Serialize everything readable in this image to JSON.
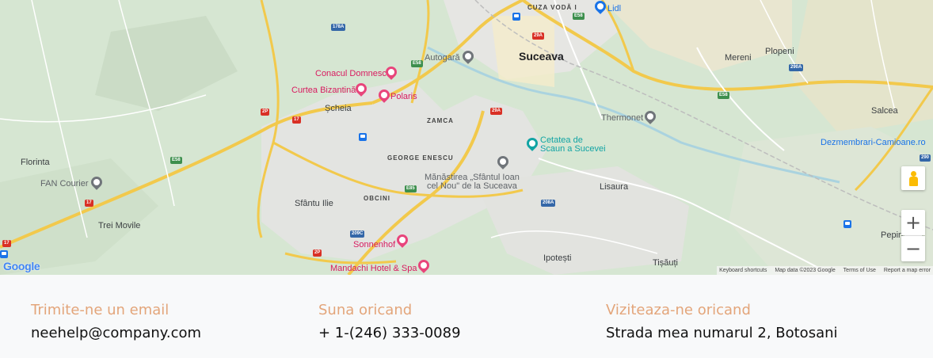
{
  "map": {
    "cities": {
      "suceava": "Suceava"
    },
    "towns": {
      "scheia": "Șcheia",
      "florinta": "Florinta",
      "trei_movile": "Trei Movile",
      "sfantu_ilie": "Sfântu Ilie",
      "lisaura": "Lisaura",
      "ipotesti": "Ipotești",
      "tisauti": "Tișăuți",
      "mereni": "Mereni",
      "plopeni": "Plopeni",
      "salcea": "Salcea",
      "pepin": "Pepin",
      "cuza_voda": "CUZA VODĂ I"
    },
    "districts": {
      "zamca": "ZAMCA",
      "george_enescu": "GEORGE ENESCU",
      "obcini": "OBCINI"
    },
    "pois": {
      "conacul": "Conacul Domnesc",
      "curtea": "Curtea Bizantină",
      "polaris": "Polaris",
      "autogara": "Autogară",
      "thermonet": "Thermonet",
      "cetatea_1": "Cetatea de",
      "cetatea_2": "Scaun a Sucevei",
      "manastirea_1": "Mănăstirea „Sfântul Ioan",
      "manastirea_2": "cel Nou\" de la Suceava",
      "fan_courier": "FAN Courier",
      "sonnenhof": "Sonnenhof",
      "mandachi": "Mandachi Hotel & Spa",
      "lidl": "Lidl",
      "dezmembrari": "Dezmembrari-Camioane.ro"
    },
    "shields": {
      "e58": "E58",
      "r17": "17",
      "r2p": "2P",
      "r29a": "29A",
      "r178a": "178A",
      "r208a": "208A",
      "r209c": "209C",
      "e85": "E85",
      "r290a": "290A",
      "r290": "290"
    },
    "controls": {
      "zoom_in": "+",
      "zoom_out": "−"
    },
    "logo": "Google",
    "attribution": {
      "shortcuts": "Keyboard shortcuts",
      "data": "Map data ©2023 Google",
      "terms": "Terms of Use",
      "report": "Report a map error"
    },
    "colors": {
      "land": "#d6e6d2",
      "urban": "#e8eaed",
      "road": "#f2c94c",
      "water": "#aad3df"
    }
  },
  "contact": {
    "email": {
      "title": "Trimite-ne un email",
      "value": "neehelp@company.com"
    },
    "phone": {
      "title": "Suna oricand",
      "value": "+ 1-(246) 333-0089"
    },
    "visit": {
      "title": "Viziteaza-ne oricand",
      "value": "Strada mea numarul 2, Botosani"
    }
  },
  "colors": {
    "accent": "#e3a57a",
    "text": "#111111",
    "footer_bg": "#f8f9fa"
  }
}
